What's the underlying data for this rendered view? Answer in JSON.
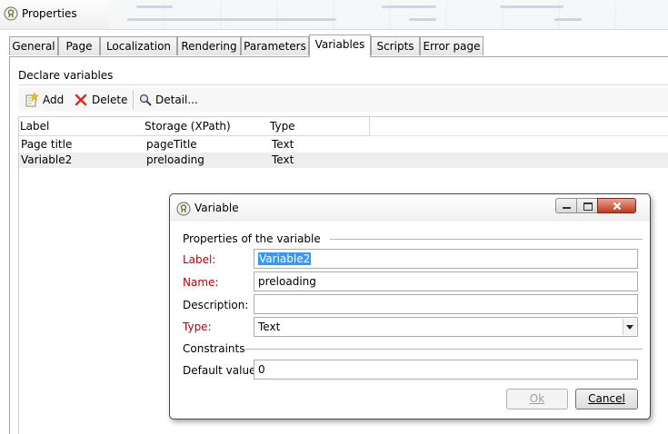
{
  "window": {
    "title": "Properties",
    "icon": "document-info-icon"
  },
  "tabs": [
    "General",
    "Page",
    "Localization",
    "Rendering",
    "Parameters",
    "Variables",
    "Scripts",
    "Error page"
  ],
  "active_tab": "Variables",
  "section": {
    "label": "Declare variables"
  },
  "toolbar": {
    "add_label": "Add",
    "delete_label": "Delete",
    "detail_label": "Detail..."
  },
  "grid": {
    "columns": [
      "Label",
      "Storage (XPath)",
      "Type"
    ],
    "rows": [
      {
        "label": "Page title",
        "storage": "pageTitle",
        "type": "Text"
      },
      {
        "label": "Variable2",
        "storage": "preloading",
        "type": "Text"
      }
    ],
    "selected_row": 1
  },
  "dialog": {
    "title": "Variable",
    "group_properties": "Properties of the variable",
    "label_caption": "Label:",
    "label_value": "Variable2",
    "name_caption": "Name:",
    "name_value": "preloading",
    "description_caption": "Description:",
    "description_value": "",
    "type_caption": "Type:",
    "type_value": "Text",
    "group_constraints": "Constraints",
    "default_caption": "Default value:",
    "default_value": "0",
    "ok_label": "Ok",
    "cancel_label": "Cancel"
  },
  "colors": {
    "required_label": "#c00000",
    "selection": "#3399ff",
    "close_button": "#c2391d"
  }
}
